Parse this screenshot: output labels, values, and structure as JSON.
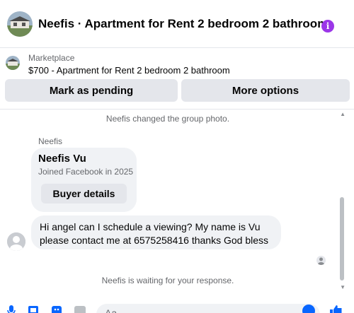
{
  "header": {
    "title": "Neefis · Apartment for Rent 2 bedroom 2 bathroom",
    "info_icon": "info-icon"
  },
  "marketplace": {
    "label": "Marketplace",
    "listing": "$700 - Apartment for Rent 2 bedroom 2 bathroom",
    "pending_button": "Mark as pending",
    "more_button": "More options"
  },
  "conversation": {
    "group_photo_notice": "Neefis changed the group photo.",
    "sender_name": "Neefis",
    "profile_card": {
      "name": "Neefis Vu",
      "joined": "Joined Facebook in 2025",
      "button": "Buyer details"
    },
    "message": "Hi angel can I schedule a viewing? My name is Vu please contact me at 6575258416 thanks God bless",
    "waiting_notice": "Neefis is waiting for your response."
  },
  "composer": {
    "placeholder": "Aa",
    "icons": [
      "microphone-icon",
      "image-icon",
      "sticker-icon",
      "gif-icon",
      "emoji-icon",
      "thumbs-up-icon"
    ]
  },
  "colors": {
    "accent": "#0866ff",
    "info": "#9b36e8",
    "bubble": "#f0f2f5",
    "button": "#e4e6eb"
  }
}
